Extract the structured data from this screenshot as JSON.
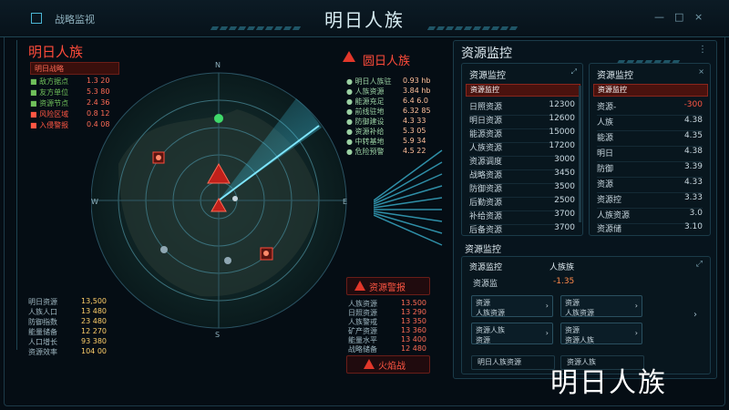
{
  "window": {
    "title": "明日人族",
    "top_left_label": "战略监视",
    "controls": [
      "—",
      "□",
      "×"
    ]
  },
  "left_panel": {
    "title": "明日人族",
    "subtitle": "明日战略",
    "legend": [
      {
        "label": "■ 敌方据点",
        "value": "1.3 20"
      },
      {
        "label": "■ 友方单位",
        "value": "5.3 80"
      },
      {
        "label": "■ 资源节点",
        "value": "2.4 36"
      },
      {
        "label": "■ 风险区域",
        "value": "0.8 12"
      },
      {
        "label": "■ 入侵警报",
        "value": "0.4 08"
      }
    ],
    "stats": [
      {
        "label": "明日资源",
        "value": "13,500"
      },
      {
        "label": "人族人口",
        "value": "13 480"
      },
      {
        "label": "防御指数",
        "value": "23 480"
      },
      {
        "label": "能量储备",
        "value": "12 270"
      },
      {
        "label": "人口增长",
        "value": "93 380"
      },
      {
        "label": "资源效率",
        "value": "104 00"
      }
    ]
  },
  "radar": {
    "north_label": "N",
    "south_label": "S",
    "west_label": "W",
    "east_label": "E",
    "alert_headline": "圆日人族",
    "alert_rows": [
      {
        "label": "● 明日人族驻",
        "value": "0.93 hb"
      },
      {
        "label": "● 人族资源",
        "value": "3.84 hb"
      },
      {
        "label": "● 能源充足",
        "value": "6.4 6.0"
      },
      {
        "label": "● 前线驻地",
        "value": "6.32 85"
      },
      {
        "label": "● 防御建设",
        "value": "4.3 33"
      },
      {
        "label": "● 资源补给",
        "value": "5.3 05"
      },
      {
        "label": "● 中转基地",
        "value": "5.9 34"
      },
      {
        "label": "● 危险预警",
        "value": "4.5 22"
      }
    ],
    "bottom_alert_title": "资源警报",
    "bottom_rows": [
      {
        "label": "人族资源",
        "value": "13.500"
      },
      {
        "label": "日照资源",
        "value": "13 290"
      },
      {
        "label": "人族警戒",
        "value": "13 350"
      },
      {
        "label": "矿产资源",
        "value": "13 360"
      },
      {
        "label": "能量水平",
        "value": "13 400"
      },
      {
        "label": "战略储备",
        "value": "12 480"
      }
    ],
    "bottom_alert_button": "火焰战"
  },
  "right_panel": {
    "title": "资源监控",
    "table_left": {
      "header": "资源监控",
      "highlight": "资源监控",
      "rows": [
        {
          "name": "日照资源",
          "value": "12300"
        },
        {
          "name": "明日资源",
          "value": "12600"
        },
        {
          "name": "能源资源",
          "value": "15000"
        },
        {
          "name": "人族资源",
          "value": "17200"
        },
        {
          "name": "资源调度",
          "value": "3000"
        },
        {
          "name": "战略资源",
          "value": "3450"
        },
        {
          "name": "防御资源",
          "value": "3500"
        },
        {
          "name": "后勤资源",
          "value": "2500"
        },
        {
          "name": "补给资源",
          "value": "3700"
        },
        {
          "name": "后备资源",
          "value": "3700"
        }
      ]
    },
    "table_right": {
      "header": "资源监控",
      "highlight": "资源监控",
      "rows": [
        {
          "name": "资源-",
          "value": "-300"
        },
        {
          "name": "人族",
          "value": "4.38"
        },
        {
          "name": "能源",
          "value": "4.35"
        },
        {
          "name": "明日",
          "value": "4.38"
        },
        {
          "name": "防御",
          "value": "3.39"
        },
        {
          "name": "资源",
          "value": "4.33"
        },
        {
          "name": "资源控",
          "value": "3.33"
        },
        {
          "name": "人族资源",
          "value": "3.0"
        },
        {
          "name": "资源储",
          "value": "3.10"
        }
      ]
    },
    "section2_title": "资源监控",
    "section2_header_left": "资源监控",
    "section2_header_right": "人族族",
    "s2_label": "资源监",
    "s2_value": "-1.35",
    "buttons": [
      {
        "top": "资源",
        "bottom": "人族资源"
      },
      {
        "top": "资源",
        "bottom": "人族资源"
      },
      {
        "top": "资源人族",
        "bottom": "资源"
      },
      {
        "top": "资源",
        "bottom": "资源人族"
      }
    ],
    "footer_left": "明日人族资源",
    "footer_right": "资源人族"
  },
  "brand": "明日人族",
  "colors": {
    "accent": "#3fc3e0",
    "alert": "#ff4b3a",
    "bg": "#050d14"
  }
}
